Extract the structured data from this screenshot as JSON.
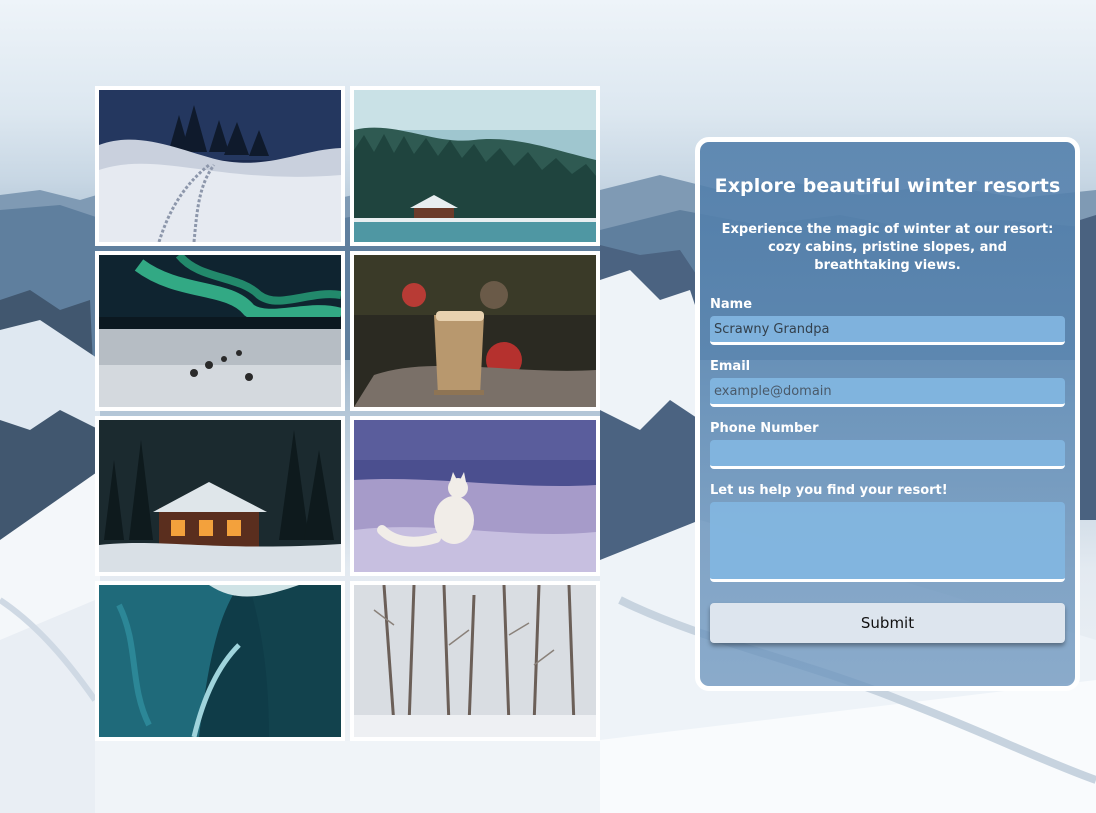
{
  "gallery": {
    "images": [
      {
        "name": "snowy-hills-night-image"
      },
      {
        "name": "lakeside-cabin-forest-image"
      },
      {
        "name": "aurora-dog-sled-image"
      },
      {
        "name": "winter-coffee-image"
      },
      {
        "name": "snow-cabin-night-image"
      },
      {
        "name": "arctic-fox-image"
      },
      {
        "name": "ice-cave-image"
      },
      {
        "name": "snowy-forest-image"
      }
    ]
  },
  "form": {
    "title": "Explore beautiful winter resorts",
    "description": "Experience the magic of winter at our resort: cozy cabins, pristine slopes, and breathtaking views.",
    "name_label": "Name",
    "name_value": "Scrawny Grandpa",
    "email_label": "Email",
    "email_placeholder": "example@domain",
    "phone_label": "Phone Number",
    "phone_value": "",
    "message_label": "Let us help you find your resort!",
    "message_value": "",
    "submit_label": "Submit"
  },
  "colors": {
    "panel": "#5a85b0",
    "input": "#82b6e1",
    "button": "#dde5ee",
    "border": "#ffffff"
  }
}
